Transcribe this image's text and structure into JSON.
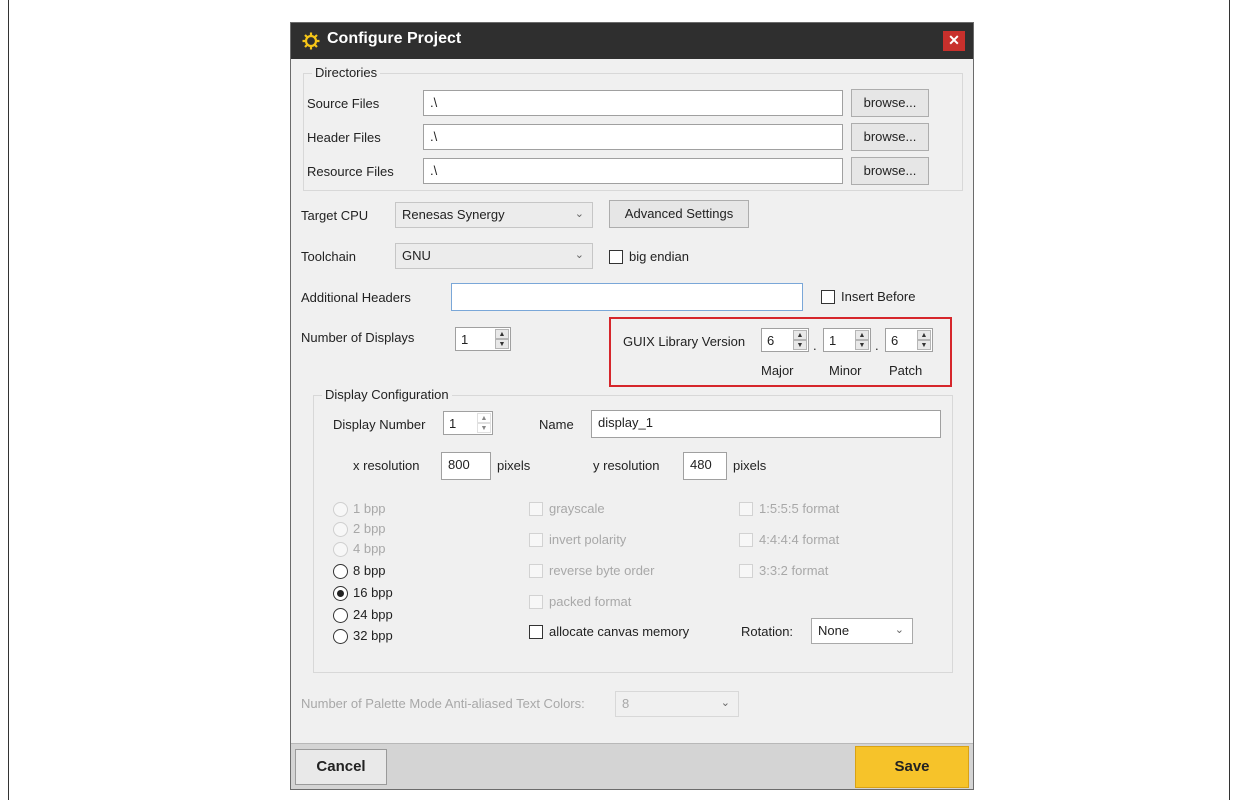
{
  "window": {
    "title": "Configure Project",
    "close_glyph": "✕"
  },
  "directories": {
    "legend": "Directories",
    "source_label": "Source Files",
    "source_value": ".\\",
    "header_label": "Header Files",
    "header_value": ".\\",
    "resource_label": "Resource Files",
    "resource_value": ".\\",
    "browse_label": "browse..."
  },
  "target": {
    "cpu_label": "Target CPU",
    "cpu_value": "Renesas Synergy",
    "advanced_label": "Advanced Settings",
    "toolchain_label": "Toolchain",
    "toolchain_value": "GNU",
    "big_endian_label": "big endian",
    "additional_headers_label": "Additional Headers",
    "additional_headers_value": "",
    "insert_before_label": "Insert Before",
    "num_displays_label": "Number of Displays",
    "num_displays_value": "1"
  },
  "guix": {
    "label": "GUIX Library Version",
    "major": "6",
    "minor": "1",
    "patch": "6",
    "dot": ".",
    "major_label": "Major",
    "minor_label": "Minor",
    "patch_label": "Patch",
    "highlight_color": "#d6262b"
  },
  "display_config": {
    "legend": "Display Configuration",
    "display_number_label": "Display Number",
    "display_number_value": "1",
    "name_label": "Name",
    "name_value": "display_1",
    "x_res_label": "x resolution",
    "x_res_value": "800",
    "y_res_label": "y resolution",
    "y_res_value": "480",
    "pixels_label": "pixels",
    "bpp_options": [
      {
        "label": "1 bpp",
        "enabled": false,
        "checked": false
      },
      {
        "label": "2 bpp",
        "enabled": false,
        "checked": false
      },
      {
        "label": "4 bpp",
        "enabled": false,
        "checked": false
      },
      {
        "label": "8 bpp",
        "enabled": true,
        "checked": false
      },
      {
        "label": "16 bpp",
        "enabled": true,
        "checked": true
      },
      {
        "label": "24 bpp",
        "enabled": true,
        "checked": false
      },
      {
        "label": "32 bpp",
        "enabled": true,
        "checked": false
      }
    ],
    "flags": [
      {
        "label": "grayscale",
        "enabled": false
      },
      {
        "label": "invert polarity",
        "enabled": false
      },
      {
        "label": "reverse byte order",
        "enabled": false
      },
      {
        "label": "packed format",
        "enabled": false
      },
      {
        "label": "allocate canvas memory",
        "enabled": true
      }
    ],
    "formats": [
      {
        "label": "1:5:5:5 format",
        "enabled": false
      },
      {
        "label": "4:4:4:4 format",
        "enabled": false
      },
      {
        "label": "3:3:2 format",
        "enabled": false
      }
    ],
    "rotation_label": "Rotation:",
    "rotation_value": "None"
  },
  "palette": {
    "label": "Number of Palette Mode Anti-aliased Text Colors:",
    "value": "8"
  },
  "footer": {
    "cancel_label": "Cancel",
    "save_label": "Save",
    "save_color": "#f6c32a"
  }
}
